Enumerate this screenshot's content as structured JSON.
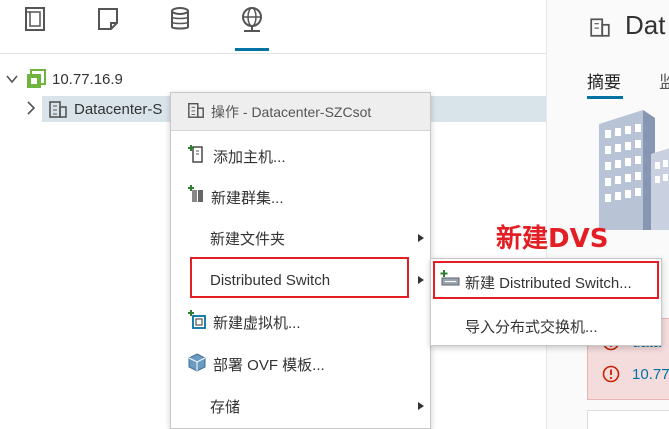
{
  "nav": {
    "tabs": [
      {
        "name": "hosts-clusters",
        "icon": "hosts-clusters-icon"
      },
      {
        "name": "vms-templates",
        "icon": "vms-templates-icon"
      },
      {
        "name": "storage",
        "icon": "storage-icon"
      },
      {
        "name": "networking",
        "icon": "networking-icon",
        "active": true
      }
    ],
    "tree": {
      "vcenter": "10.77.16.9",
      "datacenter": "Datacenter-S"
    }
  },
  "detail": {
    "title": "Dat",
    "tabs": [
      "摘要",
      "监"
    ],
    "alerts": [
      "data",
      "10.77"
    ]
  },
  "context_menu": {
    "header": "操作 - Datacenter-SZCsot",
    "items": [
      {
        "label": "添加主机...",
        "icon": "add-host-icon",
        "has_submenu": false
      },
      {
        "label": "新建群集...",
        "icon": "new-cluster-icon",
        "has_submenu": false
      },
      {
        "label": "新建文件夹",
        "icon": "",
        "has_submenu": true
      },
      {
        "label": "Distributed Switch",
        "icon": "",
        "has_submenu": true,
        "highlighted": true
      },
      {
        "label": "新建虚拟机...",
        "icon": "new-vm-icon",
        "has_submenu": false
      },
      {
        "label": "部署 OVF 模板...",
        "icon": "deploy-ovf-icon",
        "has_submenu": false
      },
      {
        "label": "存储",
        "icon": "",
        "has_submenu": true
      }
    ]
  },
  "submenu": {
    "items": [
      {
        "label": "新建 Distributed Switch...",
        "icon": "new-dvs-icon",
        "highlighted": true
      },
      {
        "label": "导入分布式交换机...",
        "icon": ""
      }
    ]
  },
  "annotation": {
    "text": "新建DVS",
    "color": "#e31e24"
  },
  "colors": {
    "accent": "#0072a3",
    "selected_row": "#d9e4ea",
    "annotation_red": "#e31e24",
    "alert_bg": "#f5dcdc"
  }
}
